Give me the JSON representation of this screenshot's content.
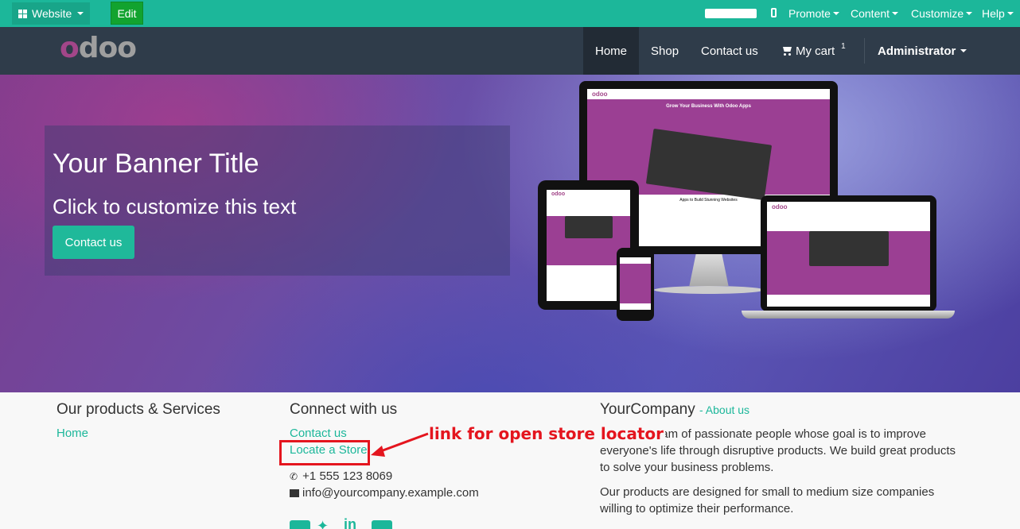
{
  "adminbar": {
    "website_label": "Website",
    "edit_label": "Edit",
    "menus": [
      "Promote",
      "Content",
      "Customize",
      "Help"
    ],
    "color": "#1cb79a"
  },
  "navbar": {
    "logo": {
      "first": "o",
      "rest": "doo"
    },
    "items": [
      "Home",
      "Shop",
      "Contact us",
      "My cart"
    ],
    "cart_count": "1",
    "user": "Administrator"
  },
  "banner": {
    "title": "Your Banner Title",
    "subtitle": "Click to customize this text",
    "button": "Contact us"
  },
  "devices": {
    "hero_title": "Grow Your Business With Odoo Apps",
    "section_title": "Apps to Build Stunning Websites",
    "logo": "odoo"
  },
  "footer": {
    "col1": {
      "heading": "Our products & Services",
      "links": [
        "Home"
      ]
    },
    "col2": {
      "heading": "Connect with us",
      "links": [
        "Contact us",
        "Locate a Store"
      ],
      "phone": "+1 555 123 8069",
      "email": "info@yourcompany.example.com"
    },
    "col3": {
      "heading": "YourCompany",
      "about_link": "- About us",
      "para1": "We are a team of passionate people whose goal is to improve everyone's life through disruptive products. We build great products to solve your business problems.",
      "para2": "Our products are designed for small to medium size companies willing to optimize their performance."
    },
    "social_icons": [
      "facebook-icon",
      "twitter-icon",
      "linkedin-icon",
      "google-plus-icon"
    ]
  },
  "annotation": {
    "text": "link for open store locator",
    "color": "#e4151e"
  }
}
